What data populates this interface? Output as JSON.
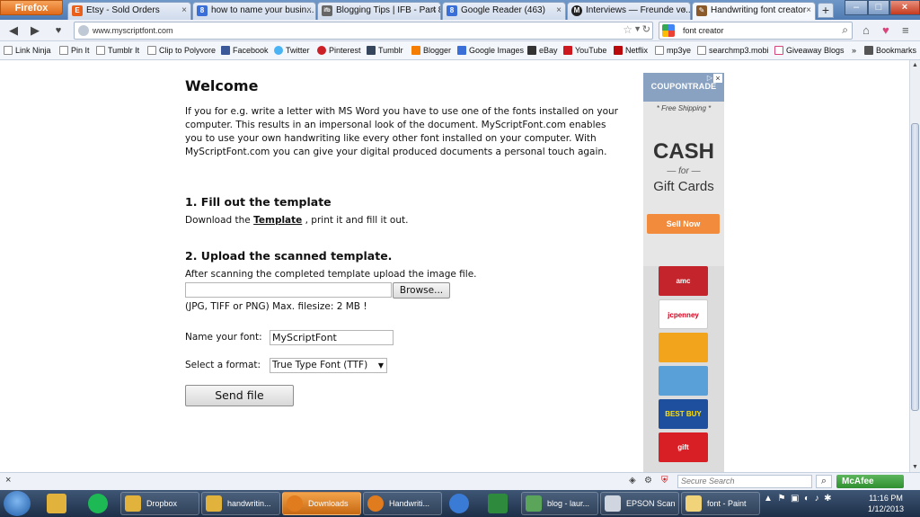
{
  "browser": {
    "app_button": "Firefox",
    "tabs": [
      {
        "label": "Etsy - Sold Orders",
        "fav": "E",
        "color": "#e8601c"
      },
      {
        "label": "how to name your busin...",
        "fav": "8",
        "color": "#3a6fd8"
      },
      {
        "label": "Blogging Tips | IFB - Part 8",
        "fav": "ifb",
        "color": "#666666"
      },
      {
        "label": "Google Reader (463)",
        "fav": "8",
        "color": "#3a6fd8"
      },
      {
        "label": "Interviews — Freunde vo...",
        "fav": "M",
        "color": "#222222"
      },
      {
        "label": "Handwriting font creator",
        "fav": "✎",
        "color": "#8b5a2b"
      }
    ],
    "new_tab": "+",
    "url": "www.myscriptfont.com",
    "search_query": "font creator",
    "bookmarks": [
      "Link Ninja",
      "Pin It",
      "Tumblr It",
      "Clip to Polyvore",
      "Facebook",
      "Twitter",
      "Pinterest",
      "Tumblr",
      "Blogger",
      "Google Images",
      "eBay",
      "YouTube",
      "Netflix",
      "mp3ye",
      "searchmp3.mobi",
      "Giveaway Blogs"
    ],
    "bookmarks_more": "»",
    "bookmarks_menu": "Bookmarks"
  },
  "page": {
    "welcome_title": "Welcome",
    "intro": "If you for e.g. write a letter with MS Word you have to use one of the fonts installed on your computer. This results in an impersonal look of the document. MyScriptFont.com enables you to use your own handwriting like every other font installed on your computer. With MyScriptFont.com you can give your digital produced documents a personal touch again.",
    "step1_title": "1. Fill out the template",
    "step1_text_before": "Download the ",
    "step1_link": "Template",
    "step1_text_after": " , print it and fill it out.",
    "step2_title": "2. Upload the scanned template.",
    "step2_text": "After scanning the completed template upload the image file.",
    "browse_label": "Browse...",
    "file_hint": "(JPG, TIFF or PNG) Max. filesize: 2 MB !",
    "name_label": "Name your font:",
    "name_value": "MyScriptFont",
    "format_label": "Select a format:",
    "format_value": "True Type Font (TTF)",
    "send_label": "Send file"
  },
  "ad": {
    "brand": "COUPONTRADE",
    "shipping": "* Free Shipping *",
    "cash": "CASH",
    "for": "— for —",
    "gift_cards": "Gift Cards",
    "sell_now": "Sell Now",
    "cards": [
      {
        "label": "amc",
        "color": "#c4242b"
      },
      {
        "label": "jcpenney",
        "color": "#ffffff"
      },
      {
        "label": "",
        "color": "#f2a41c"
      },
      {
        "label": "",
        "color": "#5aa0d8"
      },
      {
        "label": "BEST BUY",
        "color": "#1e4f9e"
      },
      {
        "label": "gift",
        "color": "#d81f26"
      }
    ]
  },
  "statusbar": {
    "close": "×",
    "secure_search_placeholder": "Secure Search",
    "mcafee": "McAfee"
  },
  "taskbar": {
    "items": [
      {
        "label": "Dropbox",
        "color": "#e2b33c"
      },
      {
        "label": "handwritin...",
        "color": "#e2b33c"
      },
      {
        "label": "Downloads",
        "color": "#e07b1e"
      },
      {
        "label": "Handwriti...",
        "color": "#e07b1e"
      },
      {
        "label": "blog - laur...",
        "color": "#5aa55a"
      },
      {
        "label": "EPSON Scan",
        "color": "#cfd6df"
      },
      {
        "label": "font - Paint",
        "color": "#f1d37a"
      }
    ],
    "time": "11:16 PM",
    "date": "1/12/2013"
  }
}
